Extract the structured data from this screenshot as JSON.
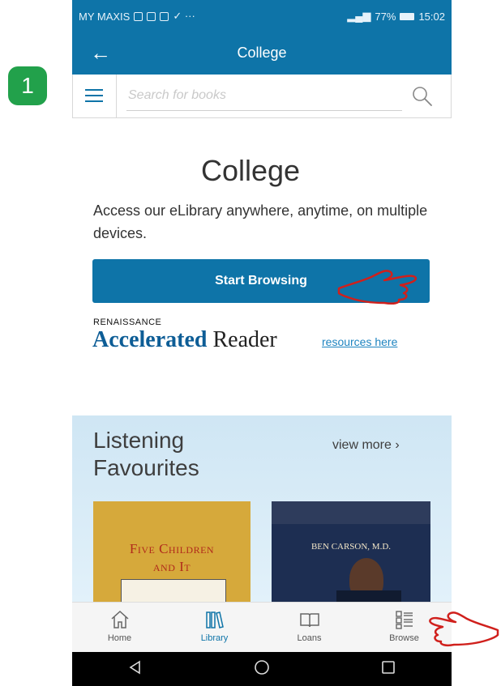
{
  "status_bar": {
    "carrier": "MY MAXIS",
    "battery": "77%",
    "time": "15:02"
  },
  "app_bar": {
    "title": "College"
  },
  "search": {
    "placeholder": "Search for books"
  },
  "annotation": {
    "step_number": "1"
  },
  "main": {
    "title": "College",
    "tagline": "Access our eLibrary anywhere, anytime, on multiple devices.",
    "start_button": "Start Browsing",
    "ar_brand": "RENAISSANCE",
    "ar_accelerated": "Accelerated",
    "ar_reader": "Reader",
    "ar_link": "resources here"
  },
  "favourites": {
    "title_line1": "Listening",
    "title_line2": "Favourites",
    "view_more": "view more",
    "book1_title_line1": "Five Children",
    "book1_title_line2": "and It",
    "book2_author": "BEN CARSON, M.D."
  },
  "bottom_nav": {
    "items": [
      {
        "label": "Home",
        "icon": "home-icon"
      },
      {
        "label": "Library",
        "icon": "library-icon"
      },
      {
        "label": "Loans",
        "icon": "book-icon"
      },
      {
        "label": "Browse",
        "icon": "list-icon"
      }
    ],
    "active_index": 1
  },
  "colors": {
    "primary": "#0e74a8",
    "step_badge": "#22a14b",
    "annotation_hand": "#d0201c"
  }
}
